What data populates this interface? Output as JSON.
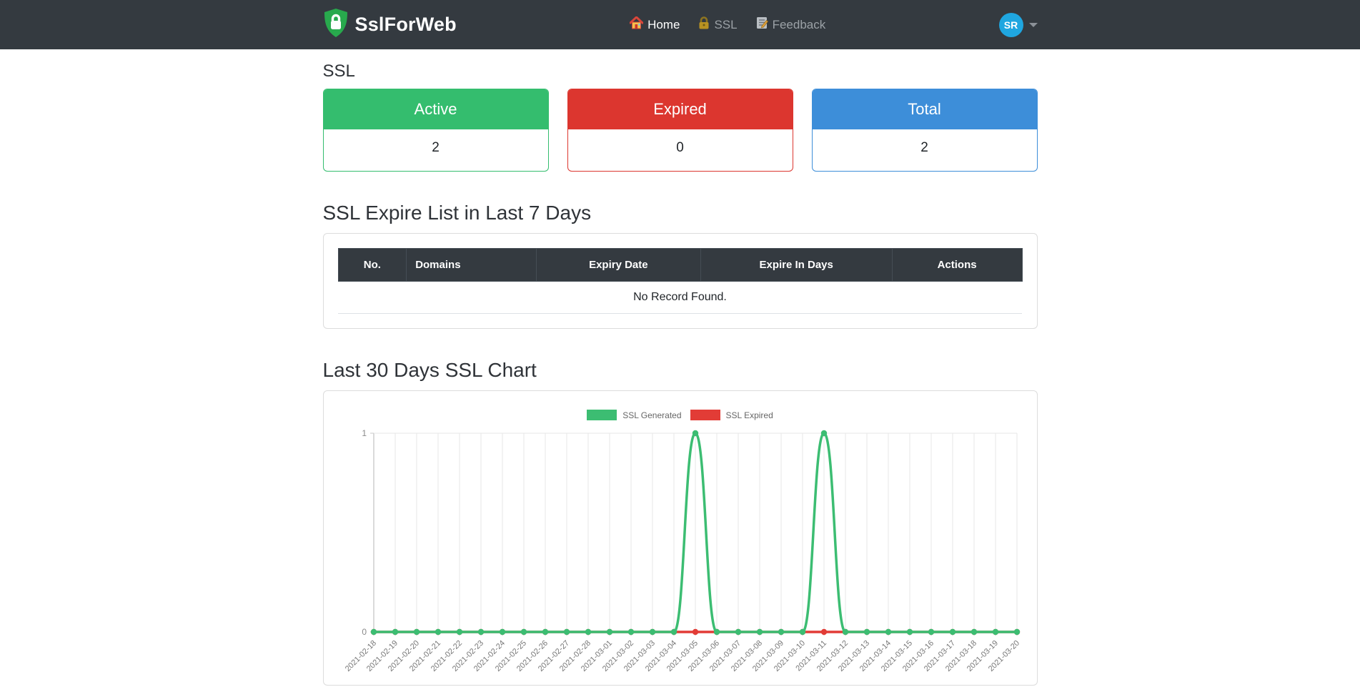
{
  "navbar": {
    "brand": "SslForWeb",
    "items": [
      {
        "label": "Home",
        "icon": "home-icon",
        "active": true
      },
      {
        "label": "SSL",
        "icon": "lock-icon",
        "active": false
      },
      {
        "label": "Feedback",
        "icon": "memo-icon",
        "active": false
      }
    ],
    "avatar_initials": "SR"
  },
  "colors": {
    "navbar_bg": "#343a40",
    "active_green": "#34bd6e",
    "expired_red": "#dc362f",
    "total_blue": "#3d8ed9",
    "avatar_blue": "#1fa6e0",
    "chart_green": "#3cbd72",
    "chart_red": "#e23c36"
  },
  "ssl_section": {
    "title": "SSL",
    "cards": [
      {
        "label": "Active",
        "value": "2",
        "color": "#34bd6e"
      },
      {
        "label": "Expired",
        "value": "0",
        "color": "#dc362f"
      },
      {
        "label": "Total",
        "value": "2",
        "color": "#3d8ed9"
      }
    ]
  },
  "expire_section": {
    "title": "SSL Expire List in Last 7 Days",
    "columns": [
      "No.",
      "Domains",
      "Expiry Date",
      "Expire In Days",
      "Actions"
    ],
    "empty_text": "No Record Found."
  },
  "chart_section": {
    "title": "Last 30 Days SSL Chart"
  },
  "chart_data": {
    "type": "line",
    "title": "Last 30 Days SSL Chart",
    "x": [
      "2021-02-18",
      "2021-02-19",
      "2021-02-20",
      "2021-02-21",
      "2021-02-22",
      "2021-02-23",
      "2021-02-24",
      "2021-02-25",
      "2021-02-26",
      "2021-02-27",
      "2021-02-28",
      "2021-03-01",
      "2021-03-02",
      "2021-03-03",
      "2021-03-04",
      "2021-03-05",
      "2021-03-06",
      "2021-03-07",
      "2021-03-08",
      "2021-03-09",
      "2021-03-10",
      "2021-03-11",
      "2021-03-12",
      "2021-03-13",
      "2021-03-14",
      "2021-03-15",
      "2021-03-16",
      "2021-03-17",
      "2021-03-18",
      "2021-03-19",
      "2021-03-20"
    ],
    "series": [
      {
        "name": "SSL Generated",
        "color": "#3cbd72",
        "values": [
          0,
          0,
          0,
          0,
          0,
          0,
          0,
          0,
          0,
          0,
          0,
          0,
          0,
          0,
          0,
          1,
          0,
          0,
          0,
          0,
          0,
          1,
          0,
          0,
          0,
          0,
          0,
          0,
          0,
          0,
          0
        ]
      },
      {
        "name": "SSL Expired",
        "color": "#e23c36",
        "values": [
          0,
          0,
          0,
          0,
          0,
          0,
          0,
          0,
          0,
          0,
          0,
          0,
          0,
          0,
          0,
          0,
          0,
          0,
          0,
          0,
          0,
          0,
          0,
          0,
          0,
          0,
          0,
          0,
          0,
          0,
          0
        ]
      }
    ],
    "ylim": [
      0,
      1
    ],
    "yticks": [
      "0",
      "1"
    ],
    "legend_position": "top-center",
    "grid": "vertical",
    "smooth": true,
    "xlabel": "",
    "ylabel": ""
  }
}
